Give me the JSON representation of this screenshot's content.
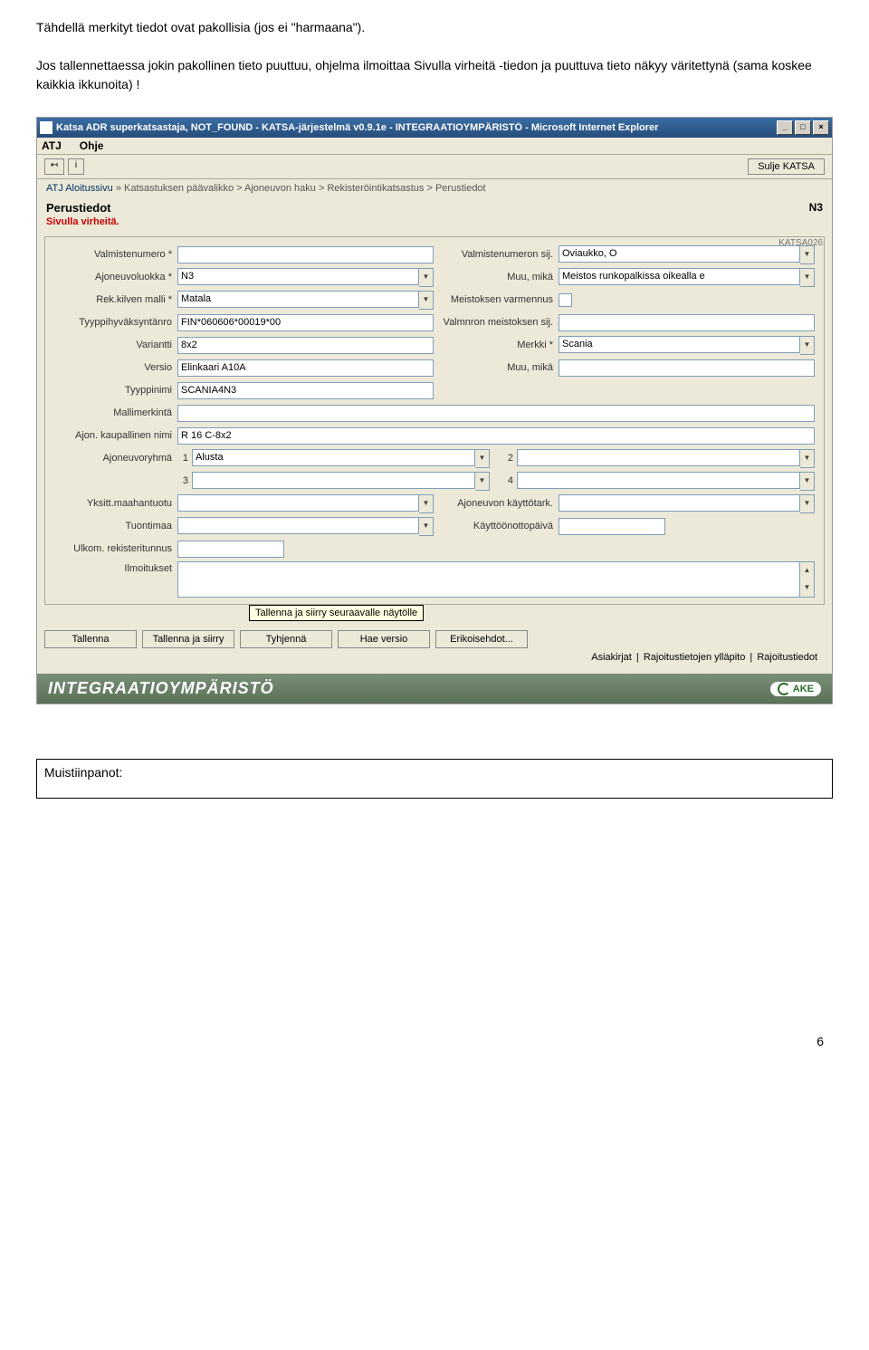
{
  "intro": {
    "p1": "Tähdellä merkityt tiedot ovat pakollisia (jos ei \"harmaana\").",
    "p2": "Jos tallennettaessa jokin pakollinen tieto puuttuu, ohjelma ilmoittaa Sivulla virheitä  -tiedon ja puuttuva tieto näkyy väritettynä (sama koskee kaikkia ikkunoita) !"
  },
  "titlebar": "Katsa ADR superkatsastaja, NOT_FOUND - KATSA-järjestelmä v0.9.1e - INTEGRAATIOYMPÄRISTÖ - Microsoft Internet Explorer",
  "menu": {
    "atj": "ATJ",
    "ohje": "Ohje"
  },
  "sulje": "Sulje KATSA",
  "breadcrumb": {
    "first": "ATJ Aloitussivu",
    "rest": " » Katsastuksen päävalikko > Ajoneuvon haku > Rekisteröintikatsastus > Perustiedot"
  },
  "header": "Perustiedot",
  "n3": "N3",
  "error": "Sivulla virheitä.",
  "katsa_code": "KATSA026",
  "left": {
    "valmistenumero": {
      "label": "Valmistenumero *",
      "value": ""
    },
    "ajoneuvoluokka": {
      "label": "Ajoneuvoluokka *",
      "value": "N3"
    },
    "rekkilven": {
      "label": "Rek.kilven malli *",
      "value": "Matala"
    },
    "tyyppihyv": {
      "label": "Tyyppihyväksyntänro",
      "value": "FIN*060606*00019*00"
    },
    "variantti": {
      "label": "Variantti",
      "value": "8x2"
    },
    "versio": {
      "label": "Versio",
      "value": "Elinkaari A10A"
    },
    "tyyppinimi": {
      "label": "Tyyppinimi",
      "value": "SCANIA4N3"
    },
    "mallimerkinta": {
      "label": "Mallimerkintä",
      "value": ""
    },
    "kaupallinen": {
      "label": "Ajon. kaupallinen nimi",
      "value": "R 16 C-8x2"
    }
  },
  "right": {
    "valmsij": {
      "label": "Valmistenumeron sij.",
      "value": "Oviaukko, O"
    },
    "muumika1": {
      "label": "Muu, mikä",
      "value": "Meistos runkopalkissa oikealla e"
    },
    "varmennus": {
      "label": "Meistoksen varmennus"
    },
    "meistsij": {
      "label": "Valmnron meistoksen sij.",
      "value": ""
    },
    "merkki": {
      "label": "Merkki *",
      "value": "Scania"
    },
    "muumika2": {
      "label": "Muu, mikä",
      "value": ""
    }
  },
  "ajoneuvoryhma": {
    "label": "Ajoneuvoryhmä",
    "n1": "1",
    "v1": "Alusta",
    "n2": "2",
    "v2": "",
    "n3": "3",
    "v3": "",
    "n4": "4",
    "v4": ""
  },
  "yksitt": {
    "label": "Yksitt.maahantuotu",
    "value": ""
  },
  "kayttotark": {
    "label": "Ajoneuvon käyttötark.",
    "value": ""
  },
  "tuontimaa": {
    "label": "Tuontimaa",
    "value": ""
  },
  "kayttoonotto": {
    "label": "Käyttöönottopäivä",
    "value": ""
  },
  "ulkom": {
    "label": "Ulkom. rekisteritunnus",
    "value": ""
  },
  "ilmoitukset": {
    "label": "Ilmoitukset"
  },
  "hint": "Tallenna ja siirry seuraavalle näytölle",
  "buttons": {
    "tallenna": "Tallenna",
    "tallenna_siirry": "Tallenna ja siirry",
    "tyhjenna": "Tyhjennä",
    "haeversio": "Hae versio",
    "erikoisehdot": "Erikoisehdot..."
  },
  "links": {
    "a": "Asiakirjat",
    "b": "Rajoitustietojen ylläpito",
    "c": "Rajoitustiedot"
  },
  "footer": "INTEGRAATIOYMPÄRISTÖ",
  "ake": "AKE",
  "notes": "Muistiinpanot:",
  "pagenum": "6"
}
